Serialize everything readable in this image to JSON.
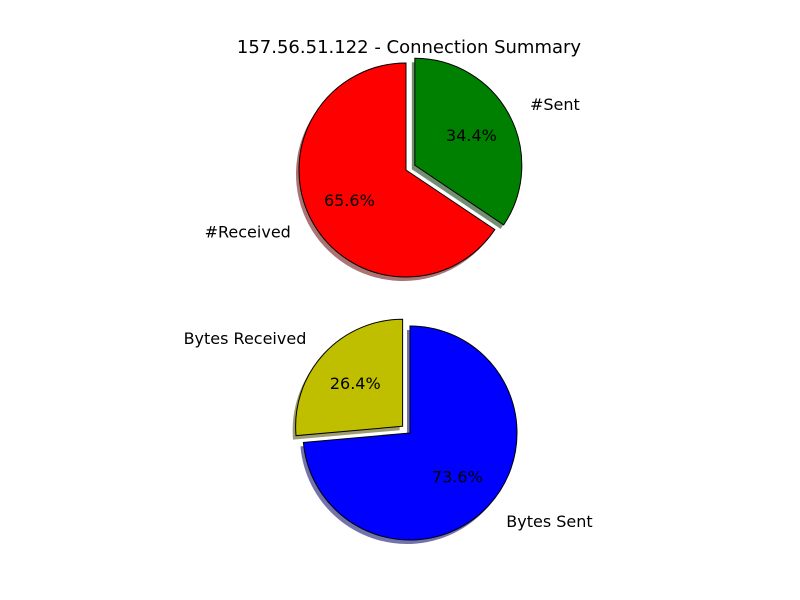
{
  "title": "157.56.51.122 - Connection Summary",
  "chart_data": [
    {
      "type": "pie",
      "slices": [
        {
          "label": "#Sent",
          "percent": 34.4,
          "pct_label": "34.4%",
          "color": "#008000",
          "exploded": true
        },
        {
          "label": "#Received",
          "percent": 65.6,
          "pct_label": "65.6%",
          "color": "#ff0000",
          "exploded": false
        }
      ],
      "start_angle_deg": 90,
      "direction": "clockwise",
      "shadow": true
    },
    {
      "type": "pie",
      "slices": [
        {
          "label": "Bytes Sent",
          "percent": 73.6,
          "pct_label": "73.6%",
          "color": "#0000ff",
          "exploded": false
        },
        {
          "label": "Bytes Received",
          "percent": 26.4,
          "pct_label": "26.4%",
          "color": "#bfbf00",
          "exploded": true
        }
      ],
      "start_angle_deg": 90,
      "direction": "clockwise",
      "shadow": true
    }
  ]
}
